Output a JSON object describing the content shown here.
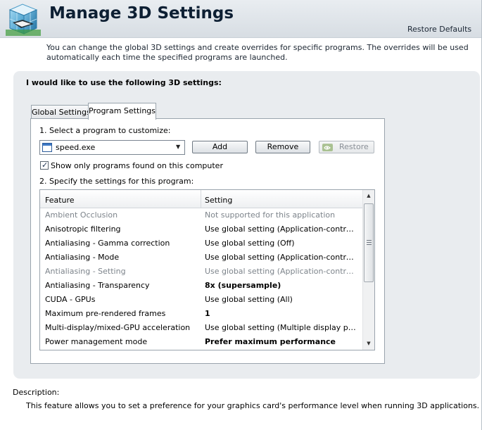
{
  "header": {
    "title": "Manage 3D Settings",
    "restore_defaults": "Restore Defaults",
    "icon": "nvidia-3d-settings-icon"
  },
  "intro_text": "You can change the global 3D settings and create overrides for specific programs. The overrides will be used automatically each time the specified programs are launched.",
  "panel": {
    "heading": "I would like to use the following 3D settings:",
    "tabs": [
      {
        "label": "Global Settings",
        "active": false
      },
      {
        "label": "Program Settings",
        "active": true
      }
    ],
    "select_label": "1. Select a program to customize:",
    "program": {
      "value": "speed.exe",
      "icon": "application-window-icon"
    },
    "buttons": {
      "add": "Add",
      "remove": "Remove",
      "restore": "Restore"
    },
    "checkbox": {
      "label": "Show only programs found on this computer",
      "checked": true
    },
    "specify_label": "2. Specify the settings for this program:",
    "table": {
      "headers": {
        "feature": "Feature",
        "setting": "Setting"
      },
      "rows": [
        {
          "feature": "Ambient Occlusion",
          "setting": "Not supported for this application",
          "state": "disabled"
        },
        {
          "feature": "Anisotropic filtering",
          "setting": "Use global setting (Application-controlled)",
          "state": "normal"
        },
        {
          "feature": "Antialiasing - Gamma correction",
          "setting": "Use global setting (Off)",
          "state": "normal"
        },
        {
          "feature": "Antialiasing - Mode",
          "setting": "Use global setting (Application-controlled)",
          "state": "normal"
        },
        {
          "feature": "Antialiasing - Setting",
          "setting": "Use global setting (Application-controlled)",
          "state": "disabled"
        },
        {
          "feature": "Antialiasing - Transparency",
          "setting": "8x (supersample)",
          "state": "bold"
        },
        {
          "feature": "CUDA - GPUs",
          "setting": "Use global setting (All)",
          "state": "normal"
        },
        {
          "feature": "Maximum pre-rendered frames",
          "setting": "1",
          "state": "bold"
        },
        {
          "feature": "Multi-display/mixed-GPU acceleration",
          "setting": "Use global setting (Multiple display perfor...",
          "state": "normal"
        },
        {
          "feature": "Power management mode",
          "setting": "Prefer maximum performance",
          "state": "bold"
        }
      ]
    }
  },
  "description": {
    "label": "Description:",
    "text": "This feature allows you to set a preference for your graphics card's performance level when running 3D applications."
  },
  "colors": {
    "header_bg": "#dfe4e9",
    "panel_bg": "#e9ecef",
    "title_text": "#0d1f33",
    "disabled_text": "#7d848b"
  }
}
